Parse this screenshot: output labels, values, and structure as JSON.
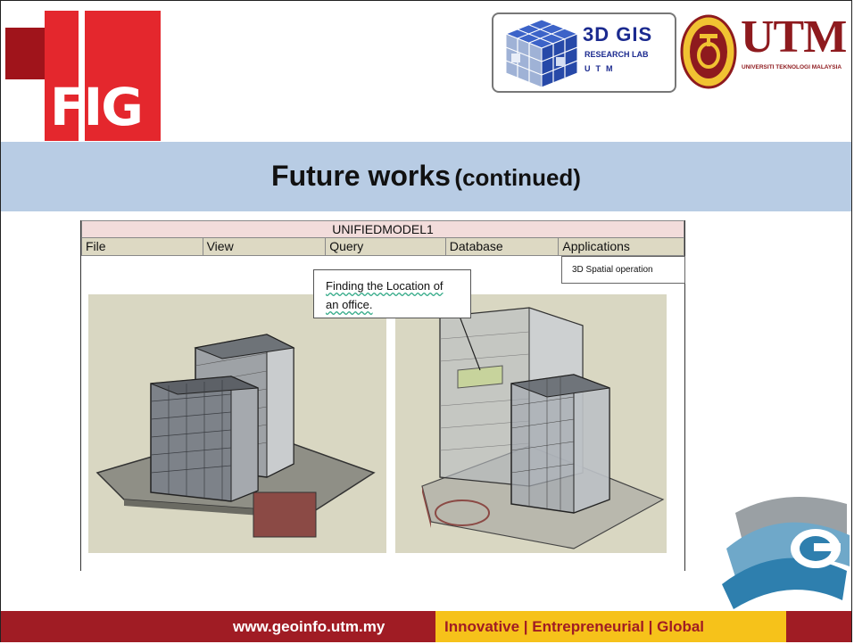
{
  "logos": {
    "fig": "FIG",
    "gis_title": "3D GIS",
    "gis_sub": "RESEARCH LAB",
    "gis_sub2": "UTM",
    "utm": "UTM",
    "utm_sub": "UNIVERSITI TEKNOLOGI MALAYSIA"
  },
  "slide": {
    "title": "Future works",
    "title_suffix": "(continued)"
  },
  "window": {
    "title": "UNIFIEDMODEL1",
    "menu": [
      "File",
      "View",
      "Query",
      "Database",
      "Applications"
    ],
    "dropdown_item": "3D Spatial operation",
    "callout_line1": "Finding the Location of",
    "callout_line2": "an office."
  },
  "footer": {
    "url": "www.geoinfo.utm.my",
    "tagline": "Innovative | Entrepreneurial | Global"
  },
  "colors": {
    "fig_red": "#e4272d",
    "title_band": "#b8cce4",
    "footer_red": "#a01c24",
    "footer_yellow": "#f6c21a",
    "utm_maroon": "#8e1a1e"
  }
}
